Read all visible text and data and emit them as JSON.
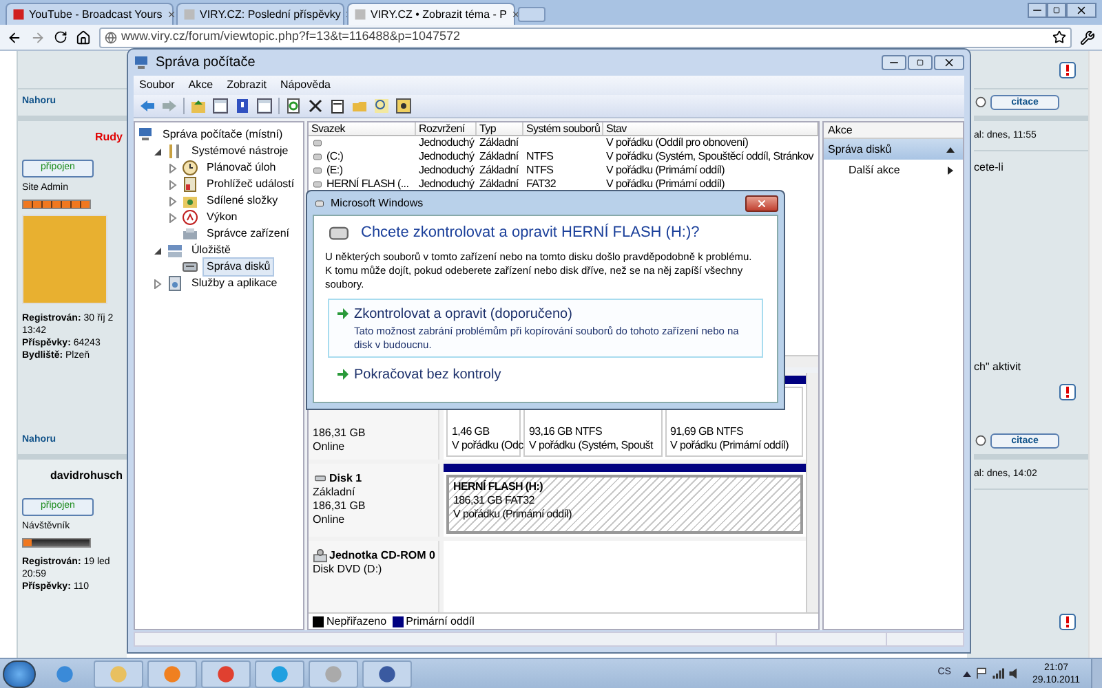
{
  "browser": {
    "tabs": [
      {
        "label": "YouTube - Broadcast Yours",
        "selected": false
      },
      {
        "label": "VIRY.CZ: Poslední příspěvky",
        "selected": false
      },
      {
        "label": "VIRY.CZ • Zobrazit téma - P",
        "selected": true
      }
    ],
    "address": "www.viry.cz/forum/viewtopic.php?f=13&t=116488&p=1047572"
  },
  "forum": {
    "rows": [
      {
        "kind": "tail",
        "report": true
      },
      {
        "kind": "nav",
        "link": "Nahoru",
        "quote": "citace"
      },
      {
        "kind": "post",
        "author": "Rudy",
        "color": "#e00000",
        "status": "připojen",
        "rank": "Site Admin",
        "level": 1,
        "avatar": true,
        "info": [
          "**Registrován:** 30 říj 2",
          "13:42",
          "**Příspěvky:** 64243",
          "**Bydliště:** Plzeň"
        ],
        "date": "al: dnes, 11:55",
        "body": [
          "cete-li",
          "ch\" aktivit"
        ],
        "report": true
      },
      {
        "kind": "nav",
        "link": "Nahoru",
        "quote": "citace"
      },
      {
        "kind": "post",
        "author": "davidrohusch",
        "color": "#000000",
        "status": "připojen",
        "rank": "Návštěvník",
        "level": 0.12,
        "avatar": false,
        "info": [
          "**Registrován:** 19 led",
          "20:59",
          "**Příspěvky:** 110"
        ],
        "date": "al: dnes, 14:02",
        "body": [],
        "report": true
      }
    ]
  },
  "window": {
    "title": "Správa počítače",
    "menu": [
      "Soubor",
      "Akce",
      "Zobrazit",
      "Nápověda"
    ],
    "tree": [
      {
        "label": "Správa počítače (místní)",
        "kind": "computer",
        "selected": false,
        "children": [
          {
            "label": "Systémové nástroje",
            "kind": "tools",
            "expanded": true,
            "selected": false,
            "children": [
              {
                "label": "Plánovač úloh",
                "kind": "clock",
                "expanded": false,
                "selected": false
              },
              {
                "label": "Prohlížeč událostí",
                "kind": "log",
                "expanded": false,
                "selected": false
              },
              {
                "label": "Sdílené složky",
                "kind": "share",
                "expanded": false,
                "selected": false
              },
              {
                "label": "Výkon",
                "kind": "performance",
                "expanded": false,
                "selected": false
              },
              {
                "label": "Správce zařízení",
                "kind": "devices",
                "selected": false
              }
            ]
          },
          {
            "label": "Úložiště",
            "kind": "storage",
            "expanded": true,
            "selected": false,
            "children": [
              {
                "label": "Správa disků",
                "kind": "disk",
                "selected": true
              }
            ]
          },
          {
            "label": "Služby a aplikace",
            "kind": "services",
            "expanded": false,
            "selected": false
          }
        ]
      }
    ],
    "table": {
      "columns": [
        "Svazek",
        "Rozvržení",
        "Typ",
        "Systém souborů",
        "Stav"
      ],
      "rows": [
        [
          "",
          "Jednoduchý",
          "Základní",
          "",
          "V pořádku (Oddíl pro obnovení)"
        ],
        [
          "(C:)",
          "Jednoduchý",
          "Základní",
          "NTFS",
          "V pořádku (Systém, Spouštěcí oddíl, Stránkov"
        ],
        [
          "(E:)",
          "Jednoduchý",
          "Základní",
          "NTFS",
          "V pořádku (Primární oddíl)"
        ],
        [
          "HERNÍ FLASH (...",
          "Jednoduchý",
          "Základní",
          "FAT32",
          "V pořádku (Primární oddíl)"
        ]
      ]
    },
    "disks": [
      {
        "lines": [
          "186,31 GB",
          "Online"
        ],
        "partitions": [
          {
            "lines": [
              "1,46 GB",
              "V pořádku (Odc"
            ],
            "selected": false
          },
          {
            "lines": [
              "93,16 GB NTFS",
              "V pořádku (Systém, Spoušt"
            ],
            "selected": false
          },
          {
            "lines": [
              "91,69 GB NTFS",
              "V pořádku (Primární oddíl)"
            ],
            "selected": false
          }
        ]
      },
      {
        "kind": "disk",
        "name": "Disk 1",
        "lines": [
          "Základní",
          "186,31 GB",
          "Online"
        ],
        "partitions": [
          {
            "title": "HERNÍ FLASH  (H:)",
            "lines": [
              "186,31 GB FAT32",
              "V pořádku (Primární oddíl)"
            ],
            "selected": true
          }
        ]
      },
      {
        "kind": "cdrom",
        "name": "Jednotka CD-ROM 0",
        "lines": [
          "Disk DVD (D:)"
        ]
      }
    ],
    "legend": [
      {
        "label": "Nepřiřazeno",
        "color": "#000000"
      },
      {
        "label": "Primární oddíl",
        "color": "#000080"
      }
    ],
    "actions": {
      "title": "Akce",
      "items": [
        {
          "label": "Správa disků",
          "kind": "section",
          "selected": true
        },
        {
          "label": "Další akce",
          "kind": "item",
          "selected": false
        }
      ]
    }
  },
  "dialog": {
    "title": "Microsoft Windows",
    "heading": "Chcete zkontrolovat a opravit HERNÍ FLASH (H:)?",
    "text": "U některých souborů v tomto zařízení nebo na tomto disku došlo pravděpodobně k problému. K tomu může dojít, pokud odeberete zařízení nebo disk dříve, než se na něj zapíší všechny soubory.",
    "options": [
      {
        "label": "Zkontrolovat a opravit (doporučeno)",
        "description": "Tato možnost zabrání problémům při kopírování souborů do tohoto zařízení nebo na disk v budoucnu.",
        "selected": true
      },
      {
        "label": "Pokračovat bez kontroly",
        "selected": false
      }
    ]
  },
  "taskbar": {
    "language": "CS",
    "time": "21:07",
    "date": "29.10.2011"
  }
}
